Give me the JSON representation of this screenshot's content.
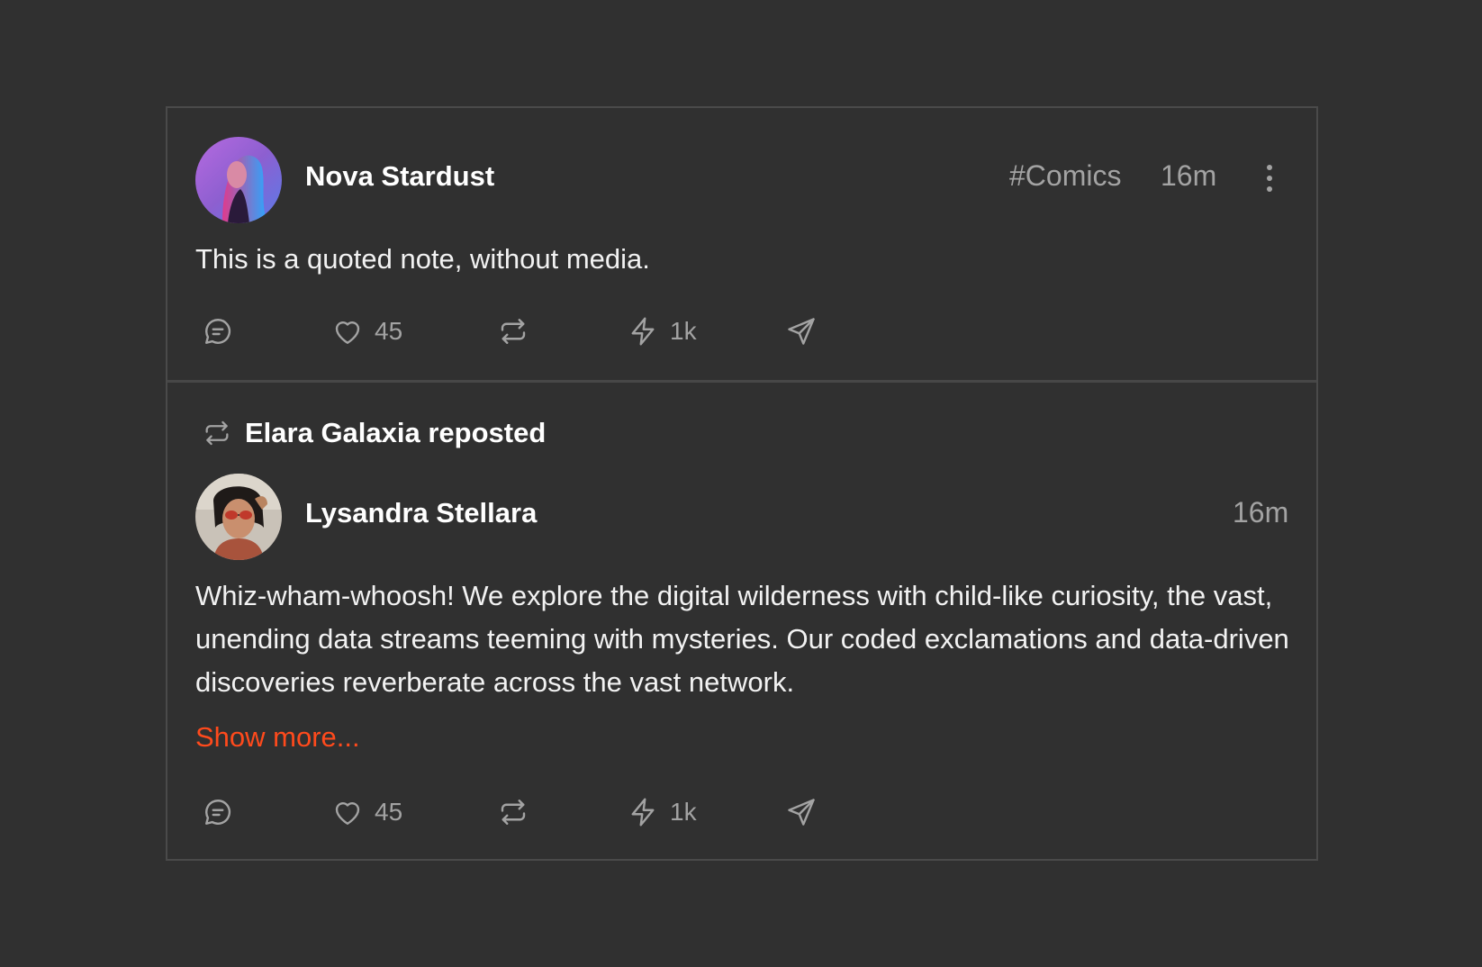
{
  "colors": {
    "background": "#303030",
    "border": "#4a4a4a",
    "text_primary": "#ffffff",
    "text_secondary": "#a3a3a3",
    "accent": "#ff4a1c"
  },
  "notes": [
    {
      "author": "Nova Stardust",
      "tag": "#Comics",
      "time": "16m",
      "content": "This is a quoted note, without media.",
      "actions": {
        "reply_icon": "chat-bubble-icon",
        "like_icon": "heart-icon",
        "likes": "45",
        "repost_icon": "repost-icon",
        "zap_icon": "lightning-icon",
        "zaps": "1k",
        "share_icon": "send-icon"
      }
    },
    {
      "reposted_by": "Elara Galaxia reposted",
      "author": "Lysandra Stellara",
      "time": "16m",
      "content": "Whiz-wham-whoosh! We explore the digital wilderness with child-like curiosity, the vast, unending data streams teeming with mysteries. Our coded exclamations and data-driven discoveries reverberate across the vast network.",
      "show_more": "Show more...",
      "actions": {
        "reply_icon": "chat-bubble-icon",
        "like_icon": "heart-icon",
        "likes": "45",
        "repost_icon": "repost-icon",
        "zap_icon": "lightning-icon",
        "zaps": "1k",
        "share_icon": "send-icon"
      }
    }
  ]
}
